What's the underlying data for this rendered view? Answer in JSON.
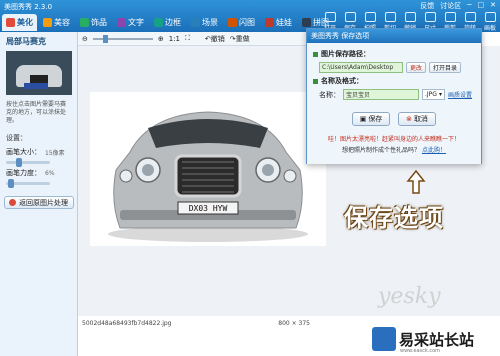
{
  "app": {
    "title": "美图秀秀 2.3.0",
    "window_controls": [
      "反馈",
      "讨论区",
      "─",
      "□",
      "✕"
    ]
  },
  "tabs": [
    {
      "label": "美化",
      "color": "#e24a3a"
    },
    {
      "label": "美容",
      "color": "#f39c12"
    },
    {
      "label": "饰品",
      "color": "#27ae60"
    },
    {
      "label": "文字",
      "color": "#8e44ad"
    },
    {
      "label": "边框",
      "color": "#16a085"
    },
    {
      "label": "场景",
      "color": "#2980b9"
    },
    {
      "label": "闪图",
      "color": "#d35400"
    },
    {
      "label": "娃娃",
      "color": "#c0392b"
    },
    {
      "label": "拼图",
      "color": "#2c3e50"
    }
  ],
  "right_tools": [
    "打开",
    "保存",
    "拍照",
    "剪切",
    "撤销",
    "尺寸",
    "裁剪",
    "旋转",
    "画板"
  ],
  "left_panel": {
    "title": "局部马赛克",
    "description": "按住点击图片需要马赛克的地方，可以涂抹处理。",
    "settings_label": "设置：",
    "brush_size_label": "画笔大小：",
    "brush_size_value": "15像素",
    "brush_strength_label": "画笔力度：",
    "brush_strength_value": "6%",
    "revert_label": "返回原图片处理"
  },
  "toolbar2": {
    "ratio": "1:1",
    "undo": "撤销",
    "redo": "重做"
  },
  "status": {
    "filename": "5002d48a68493fb7d4822.jpg",
    "dimensions": "800 × 375"
  },
  "dialog": {
    "title": "美图秀秀 保存选项",
    "path_label": "图片保存路径：",
    "path_value": "C:\\Users\\Adam\\Desktop",
    "change_button": "更改",
    "open_dir_button": "打开目录",
    "name_format_label": "名称及格式：",
    "name_label": "名称：",
    "name_value": "宝贝宝贝",
    "format_value": ".JPG",
    "quality_link": "画质设置",
    "save_button": "保存",
    "cancel_button": "取消",
    "note_text": "哇！图片太漂亮啦！赶紧叫身边的人来瞧瞧一下！",
    "note2_text": "想把照片制作成个性礼品吗？",
    "note2_link": "点此购！"
  },
  "annotation": {
    "text": "保存选项"
  },
  "watermark": {
    "text": "yesky"
  },
  "brand": {
    "name": "易采站长站",
    "sub": "www.easck.com"
  },
  "plate": {
    "text": "DX03 HYW"
  }
}
